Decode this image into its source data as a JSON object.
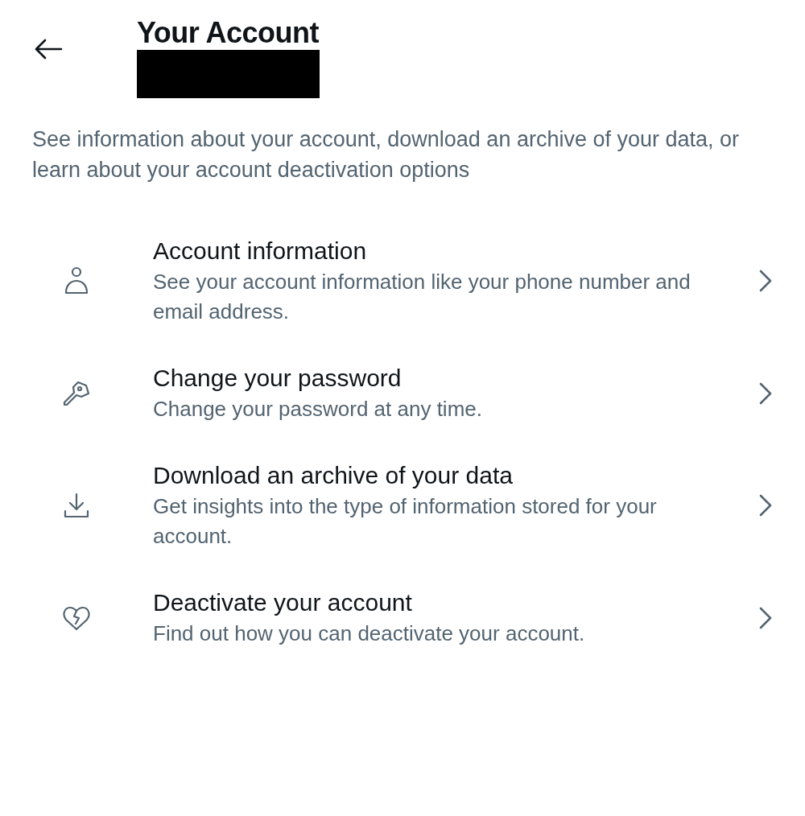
{
  "header": {
    "title": "Your Account"
  },
  "description": "See information about your account, download an archive of your data, or learn about your account deactivation options",
  "items": [
    {
      "title": "Account information",
      "subtitle": "See your account information like your phone number and email address."
    },
    {
      "title": "Change your password",
      "subtitle": "Change your password at any time."
    },
    {
      "title": "Download an archive of your data",
      "subtitle": "Get insights into the type of information stored for your account."
    },
    {
      "title": "Deactivate your account",
      "subtitle": "Find out how you can deactivate your account."
    }
  ]
}
